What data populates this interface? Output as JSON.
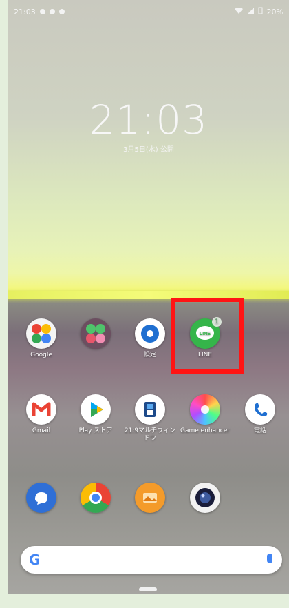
{
  "status": {
    "time": "21:03",
    "battery": "20%"
  },
  "lock": {
    "time": "21:03",
    "date": "3月5日(水) 公開"
  },
  "row1": [
    {
      "label": "Google",
      "icon": "google-folder-icon"
    },
    {
      "label": "",
      "icon": "apps-folder-icon"
    },
    {
      "label": "設定",
      "icon": "settings-gear-icon"
    },
    {
      "label": "LINE",
      "icon": "line-icon",
      "badge": "1"
    }
  ],
  "row2": [
    {
      "label": "Gmail",
      "icon": "gmail-icon"
    },
    {
      "label": "Play ストア",
      "icon": "play-store-icon"
    },
    {
      "label": "21:9マルチウィンドウ",
      "icon": "multiwindow-icon"
    },
    {
      "label": "Game enhancer",
      "icon": "game-enhancer-icon"
    },
    {
      "label": "電話",
      "icon": "phone-icon"
    }
  ],
  "dock": [
    {
      "label": "",
      "icon": "messages-icon"
    },
    {
      "label": "",
      "icon": "chrome-icon"
    },
    {
      "label": "",
      "icon": "gallery-icon"
    },
    {
      "label": "",
      "icon": "camera-icon"
    }
  ],
  "search": {
    "logo": "G"
  },
  "colors": {
    "highlight": "#ff1414",
    "line_green": "#35b54a"
  }
}
